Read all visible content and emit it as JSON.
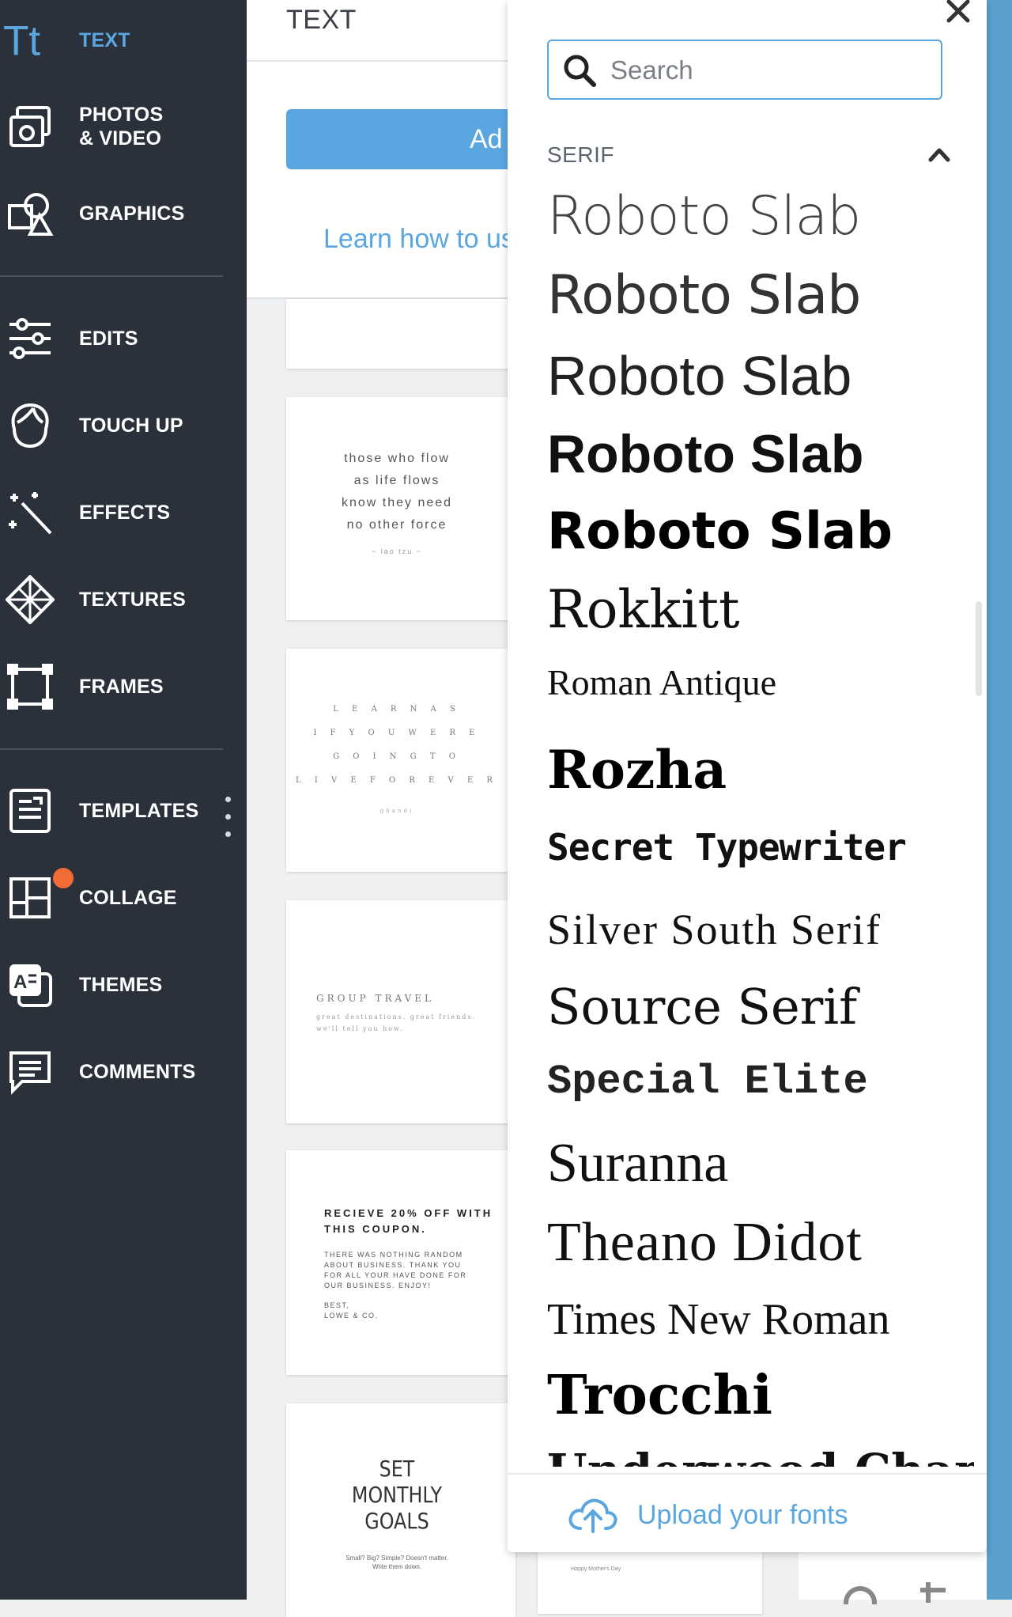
{
  "sidebar": {
    "items": [
      {
        "label": "TEXT",
        "icon": "text-tt-icon"
      },
      {
        "label": "PHOTOS\n& VIDEO",
        "icon": "photos-icon"
      },
      {
        "label": "GRAPHICS",
        "icon": "graphics-icon"
      },
      {
        "label": "EDITS",
        "icon": "sliders-icon"
      },
      {
        "label": "TOUCH UP",
        "icon": "face-icon"
      },
      {
        "label": "EFFECTS",
        "icon": "magic-wand-icon"
      },
      {
        "label": "TEXTURES",
        "icon": "texture-icon"
      },
      {
        "label": "FRAMES",
        "icon": "frame-icon"
      },
      {
        "label": "TEMPLATES",
        "icon": "template-icon"
      },
      {
        "label": "COLLAGE",
        "icon": "collage-icon"
      },
      {
        "label": "THEMES",
        "icon": "themes-icon"
      },
      {
        "label": "COMMENTS",
        "icon": "comment-icon"
      }
    ],
    "active_color": "#5aa6e0",
    "notification_color": "#f26a35"
  },
  "text_panel": {
    "title": "TEXT",
    "add_button_label": "Ad",
    "learn_link": "Learn how to us",
    "cards": {
      "quote": {
        "lines": [
          "those who flow",
          "as life flows",
          "know they need",
          "no other force"
        ],
        "credit": "~ lao tzu ~"
      },
      "spaced": {
        "lines": [
          "L E A R N   A S",
          "I F   Y O U   W E R E",
          "G O I N G   T O",
          "L I V E   F O R E V E R"
        ],
        "credit": "ghandi"
      },
      "travel": {
        "heading": "GROUP TRAVEL",
        "sub": "great destinations. great friends. we'll tell you how."
      },
      "coupon": {
        "heading": "RECIEVE 20% OFF WITH THIS COUPON.",
        "body": "THERE WAS NOTHING RANDOM ABOUT BUSINESS. THANK YOU FOR ALL YOUR HAVE DONE FOR OUR BUSINESS. ENJOY!",
        "sign": "BEST,\nLOWE & CO."
      },
      "goals": {
        "heading": "SET\nMONTHLY\nGOALS",
        "sub": "Small? Big? Simple? Doesn't matter.\nWrite them down."
      }
    },
    "bottom_card_caption": "Happy Mother's Day"
  },
  "font_picker": {
    "search_placeholder": "Search",
    "section": "SERIF",
    "fonts": [
      {
        "name": "Roboto Slab"
      },
      {
        "name": "Roboto Slab"
      },
      {
        "name": "Roboto Slab"
      },
      {
        "name": "Roboto Slab"
      },
      {
        "name": "Roboto Slab"
      },
      {
        "name": "Rokkitt"
      },
      {
        "name": "Roman Antique"
      },
      {
        "name": "Rozha"
      },
      {
        "name": "Secret Typewriter"
      },
      {
        "name": "Silver South Serif"
      },
      {
        "name": "Source Serif"
      },
      {
        "name": "Special Elite"
      },
      {
        "name": "Suranna"
      },
      {
        "name": "Theano Didot"
      },
      {
        "name": "Times New Roman"
      },
      {
        "name": "Trocchi"
      },
      {
        "name": "Underwood Champion"
      }
    ],
    "upload_label": "Upload your fonts",
    "accent_color": "#5aa6e0"
  }
}
